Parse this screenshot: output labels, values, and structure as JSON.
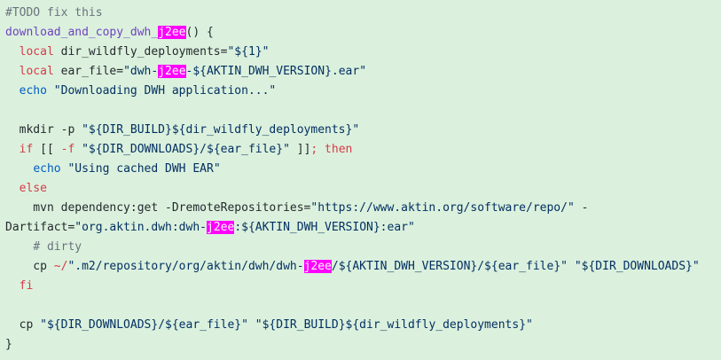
{
  "code": {
    "lines": [
      {
        "tokens": [
          {
            "text": "#TODO fix this",
            "type": "comment"
          }
        ]
      },
      {
        "tokens": [
          {
            "text": "download_and_copy_dwh_",
            "type": "func"
          },
          {
            "text": "j2ee",
            "type": "hl"
          },
          {
            "text": "() {",
            "type": "plain"
          }
        ]
      },
      {
        "tokens": [
          {
            "text": "  ",
            "type": "plain"
          },
          {
            "text": "local",
            "type": "kw"
          },
          {
            "text": " dir_wildfly_deployments=",
            "type": "plain"
          },
          {
            "text": "\"${1}\"",
            "type": "string"
          }
        ]
      },
      {
        "tokens": [
          {
            "text": "  ",
            "type": "plain"
          },
          {
            "text": "local",
            "type": "kw"
          },
          {
            "text": " ear_file=",
            "type": "plain"
          },
          {
            "text": "\"dwh-",
            "type": "string"
          },
          {
            "text": "j2ee",
            "type": "hl"
          },
          {
            "text": "-${AKTIN_DWH_VERSION}.ear\"",
            "type": "string"
          }
        ]
      },
      {
        "tokens": [
          {
            "text": "  ",
            "type": "plain"
          },
          {
            "text": "echo",
            "type": "builtin"
          },
          {
            "text": " ",
            "type": "plain"
          },
          {
            "text": "\"Downloading DWH application...\"",
            "type": "string"
          }
        ]
      },
      {
        "tokens": []
      },
      {
        "tokens": [
          {
            "text": "  mkdir -p ",
            "type": "plain"
          },
          {
            "text": "\"${DIR_BUILD}${dir_wildfly_deployments}\"",
            "type": "string"
          }
        ]
      },
      {
        "tokens": [
          {
            "text": "  ",
            "type": "plain"
          },
          {
            "text": "if",
            "type": "kw"
          },
          {
            "text": " [[ ",
            "type": "plain"
          },
          {
            "text": "-f",
            "type": "kw"
          },
          {
            "text": " ",
            "type": "plain"
          },
          {
            "text": "\"${DIR_DOWNLOADS}/${ear_file}\"",
            "type": "string"
          },
          {
            "text": " ]]",
            "type": "plain"
          },
          {
            "text": "; then",
            "type": "kw"
          }
        ]
      },
      {
        "tokens": [
          {
            "text": "    ",
            "type": "plain"
          },
          {
            "text": "echo",
            "type": "builtin"
          },
          {
            "text": " ",
            "type": "plain"
          },
          {
            "text": "\"Using cached DWH EAR\"",
            "type": "string"
          }
        ]
      },
      {
        "tokens": [
          {
            "text": "  ",
            "type": "plain"
          },
          {
            "text": "else",
            "type": "kw"
          }
        ]
      },
      {
        "tokens": [
          {
            "text": "    mvn dependency:get -DremoteRepositories=",
            "type": "plain"
          },
          {
            "text": "\"https://www.aktin.org/software/repo/\"",
            "type": "string"
          },
          {
            "text": " -",
            "type": "plain"
          }
        ]
      },
      {
        "tokens": [
          {
            "text": "Dartifact=",
            "type": "plain"
          },
          {
            "text": "\"org.aktin.dwh:dwh-",
            "type": "string"
          },
          {
            "text": "j2ee",
            "type": "hl"
          },
          {
            "text": ":${AKTIN_DWH_VERSION}:ear\"",
            "type": "string"
          }
        ]
      },
      {
        "tokens": [
          {
            "text": "    ",
            "type": "plain"
          },
          {
            "text": "# dirty",
            "type": "comment"
          }
        ]
      },
      {
        "tokens": [
          {
            "text": "    cp ",
            "type": "plain"
          },
          {
            "text": "~/",
            "type": "kw"
          },
          {
            "text": "\".m2/repository/org/aktin/dwh/dwh-",
            "type": "string"
          },
          {
            "text": "j2ee",
            "type": "hl"
          },
          {
            "text": "/${AKTIN_DWH_VERSION}/${ear_file}\"",
            "type": "string"
          },
          {
            "text": " ",
            "type": "plain"
          },
          {
            "text": "\"${DIR_DOWNLOADS}\"",
            "type": "string"
          }
        ]
      },
      {
        "tokens": [
          {
            "text": "  ",
            "type": "plain"
          },
          {
            "text": "fi",
            "type": "kw"
          }
        ]
      },
      {
        "tokens": []
      },
      {
        "tokens": [
          {
            "text": "  cp ",
            "type": "plain"
          },
          {
            "text": "\"${DIR_DOWNLOADS}/${ear_file}\"",
            "type": "string"
          },
          {
            "text": " ",
            "type": "plain"
          },
          {
            "text": "\"${DIR_BUILD}${dir_wildfly_deployments}\"",
            "type": "string"
          }
        ]
      },
      {
        "tokens": [
          {
            "text": "}",
            "type": "plain"
          }
        ]
      }
    ]
  }
}
